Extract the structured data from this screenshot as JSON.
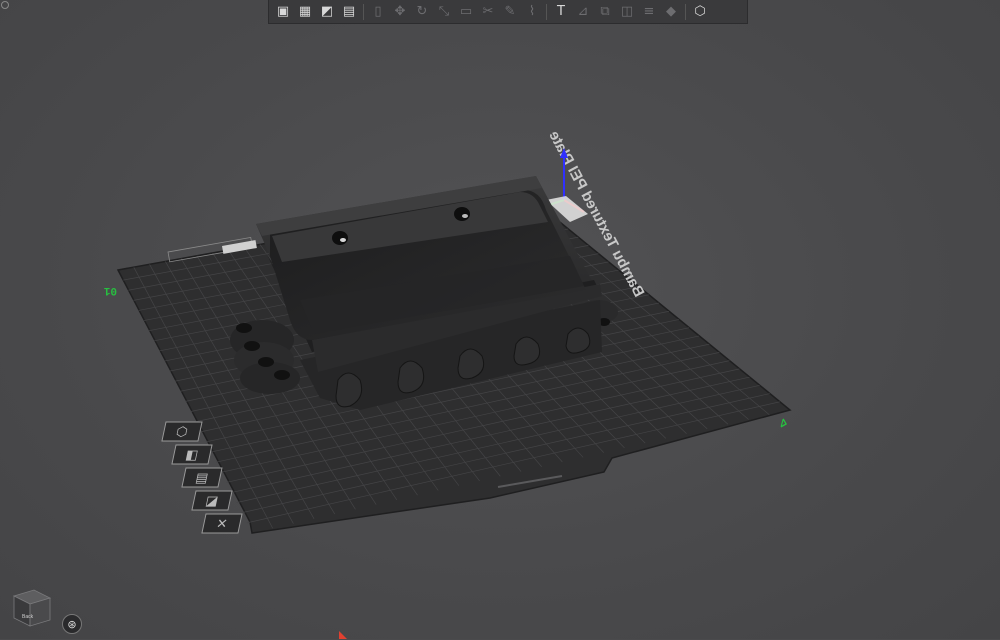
{
  "toolbar": {
    "buttons": [
      {
        "name": "add-object-icon",
        "glyph": "▣",
        "active": true
      },
      {
        "name": "arrange-grid-icon",
        "glyph": "▦",
        "active": true
      },
      {
        "name": "orient-icon",
        "glyph": "◩",
        "active": true
      },
      {
        "name": "layout-icon",
        "glyph": "▤",
        "active": true
      },
      {
        "name": "split-icon",
        "glyph": "▯",
        "active": false
      },
      {
        "name": "move-icon",
        "glyph": "✥",
        "active": false
      },
      {
        "name": "rotate-icon",
        "glyph": "↻",
        "active": false
      },
      {
        "name": "scale-icon",
        "glyph": "⤡",
        "active": false
      },
      {
        "name": "lay-flat-icon",
        "glyph": "▭",
        "active": false
      },
      {
        "name": "cut-icon",
        "glyph": "✂",
        "active": false
      },
      {
        "name": "support-paint-icon",
        "glyph": "✎",
        "active": false
      },
      {
        "name": "seam-icon",
        "glyph": "⌇",
        "active": false
      },
      {
        "name": "text-tool-icon",
        "glyph": "T",
        "active": true
      },
      {
        "name": "measure-icon",
        "glyph": "⊿",
        "active": false
      },
      {
        "name": "assembly-icon",
        "glyph": "⧉",
        "active": false
      },
      {
        "name": "boolean-icon",
        "glyph": "◫",
        "active": false
      },
      {
        "name": "variable-layer-icon",
        "glyph": "≡",
        "active": false
      },
      {
        "name": "color-paint-icon",
        "glyph": "◆",
        "active": false
      },
      {
        "name": "view-3d-icon",
        "glyph": "⬡",
        "active": true
      }
    ]
  },
  "plate": {
    "label": "Bambu Textured PEI Plate",
    "plate_number": "01"
  },
  "side_tools": [
    {
      "name": "plate-settings-icon"
    },
    {
      "name": "fill-plate-icon"
    },
    {
      "name": "arrange-plate-icon"
    },
    {
      "name": "auto-orient-plate-icon"
    },
    {
      "name": "delete-plate-icon"
    }
  ],
  "view_cube": {
    "face_label": "Back"
  },
  "colors": {
    "background": "#4a4a4c",
    "plate": "#2e2e2f",
    "grid": "#414143",
    "model": "#2a2a2a",
    "axis_x": "#ff3030",
    "axis_y": "#30c030",
    "axis_z": "#3030ff"
  }
}
